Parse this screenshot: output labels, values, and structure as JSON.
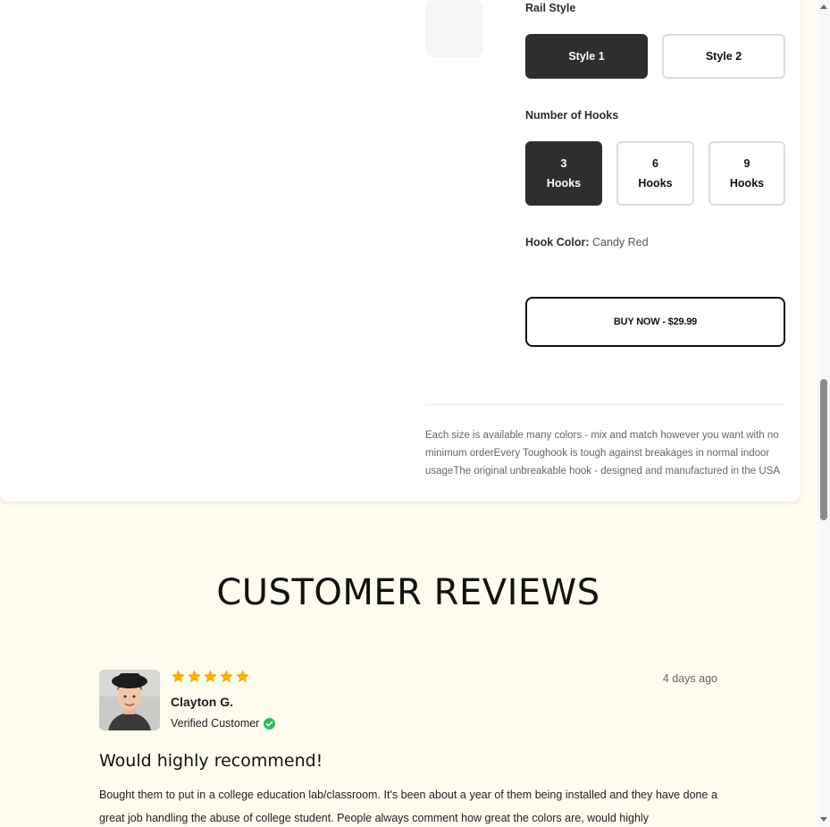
{
  "product": {
    "rail_style_label": "Rail Style",
    "rail_styles": [
      "Style 1",
      "Style 2"
    ],
    "hooks_label": "Number of Hooks",
    "hooks": [
      {
        "count": "3",
        "unit": "Hooks"
      },
      {
        "count": "6",
        "unit": "Hooks"
      },
      {
        "count": "9",
        "unit": "Hooks"
      }
    ],
    "hook_color_label": "Hook Color:",
    "hook_color_value": "Candy Red",
    "buy_label": "BUY NOW - $29.99",
    "description": "Each size is available many colors - mix and match however you want with no minimum orderEvery Toughook is tough against breakages in normal indoor usageThe original unbreakable hook - designed and manufactured in the USA"
  },
  "reviews": {
    "title": "CUSTOMER REVIEWS",
    "items": [
      {
        "name": "Clayton G.",
        "badge": "Verified Customer",
        "date": "4 days ago",
        "rating": 5,
        "title": "Would highly recommend!",
        "body": "Bought them to put in a college education lab/classroom. It's been about a year of them being installed and they have done a great job handling the abuse of college student. People always comment how great the colors are, would highly"
      }
    ]
  },
  "colors": {
    "selected": "#2e2e2e",
    "star": "#f5b301",
    "verified": "#2dbd5a",
    "reviews_bg": "#fefbef"
  }
}
